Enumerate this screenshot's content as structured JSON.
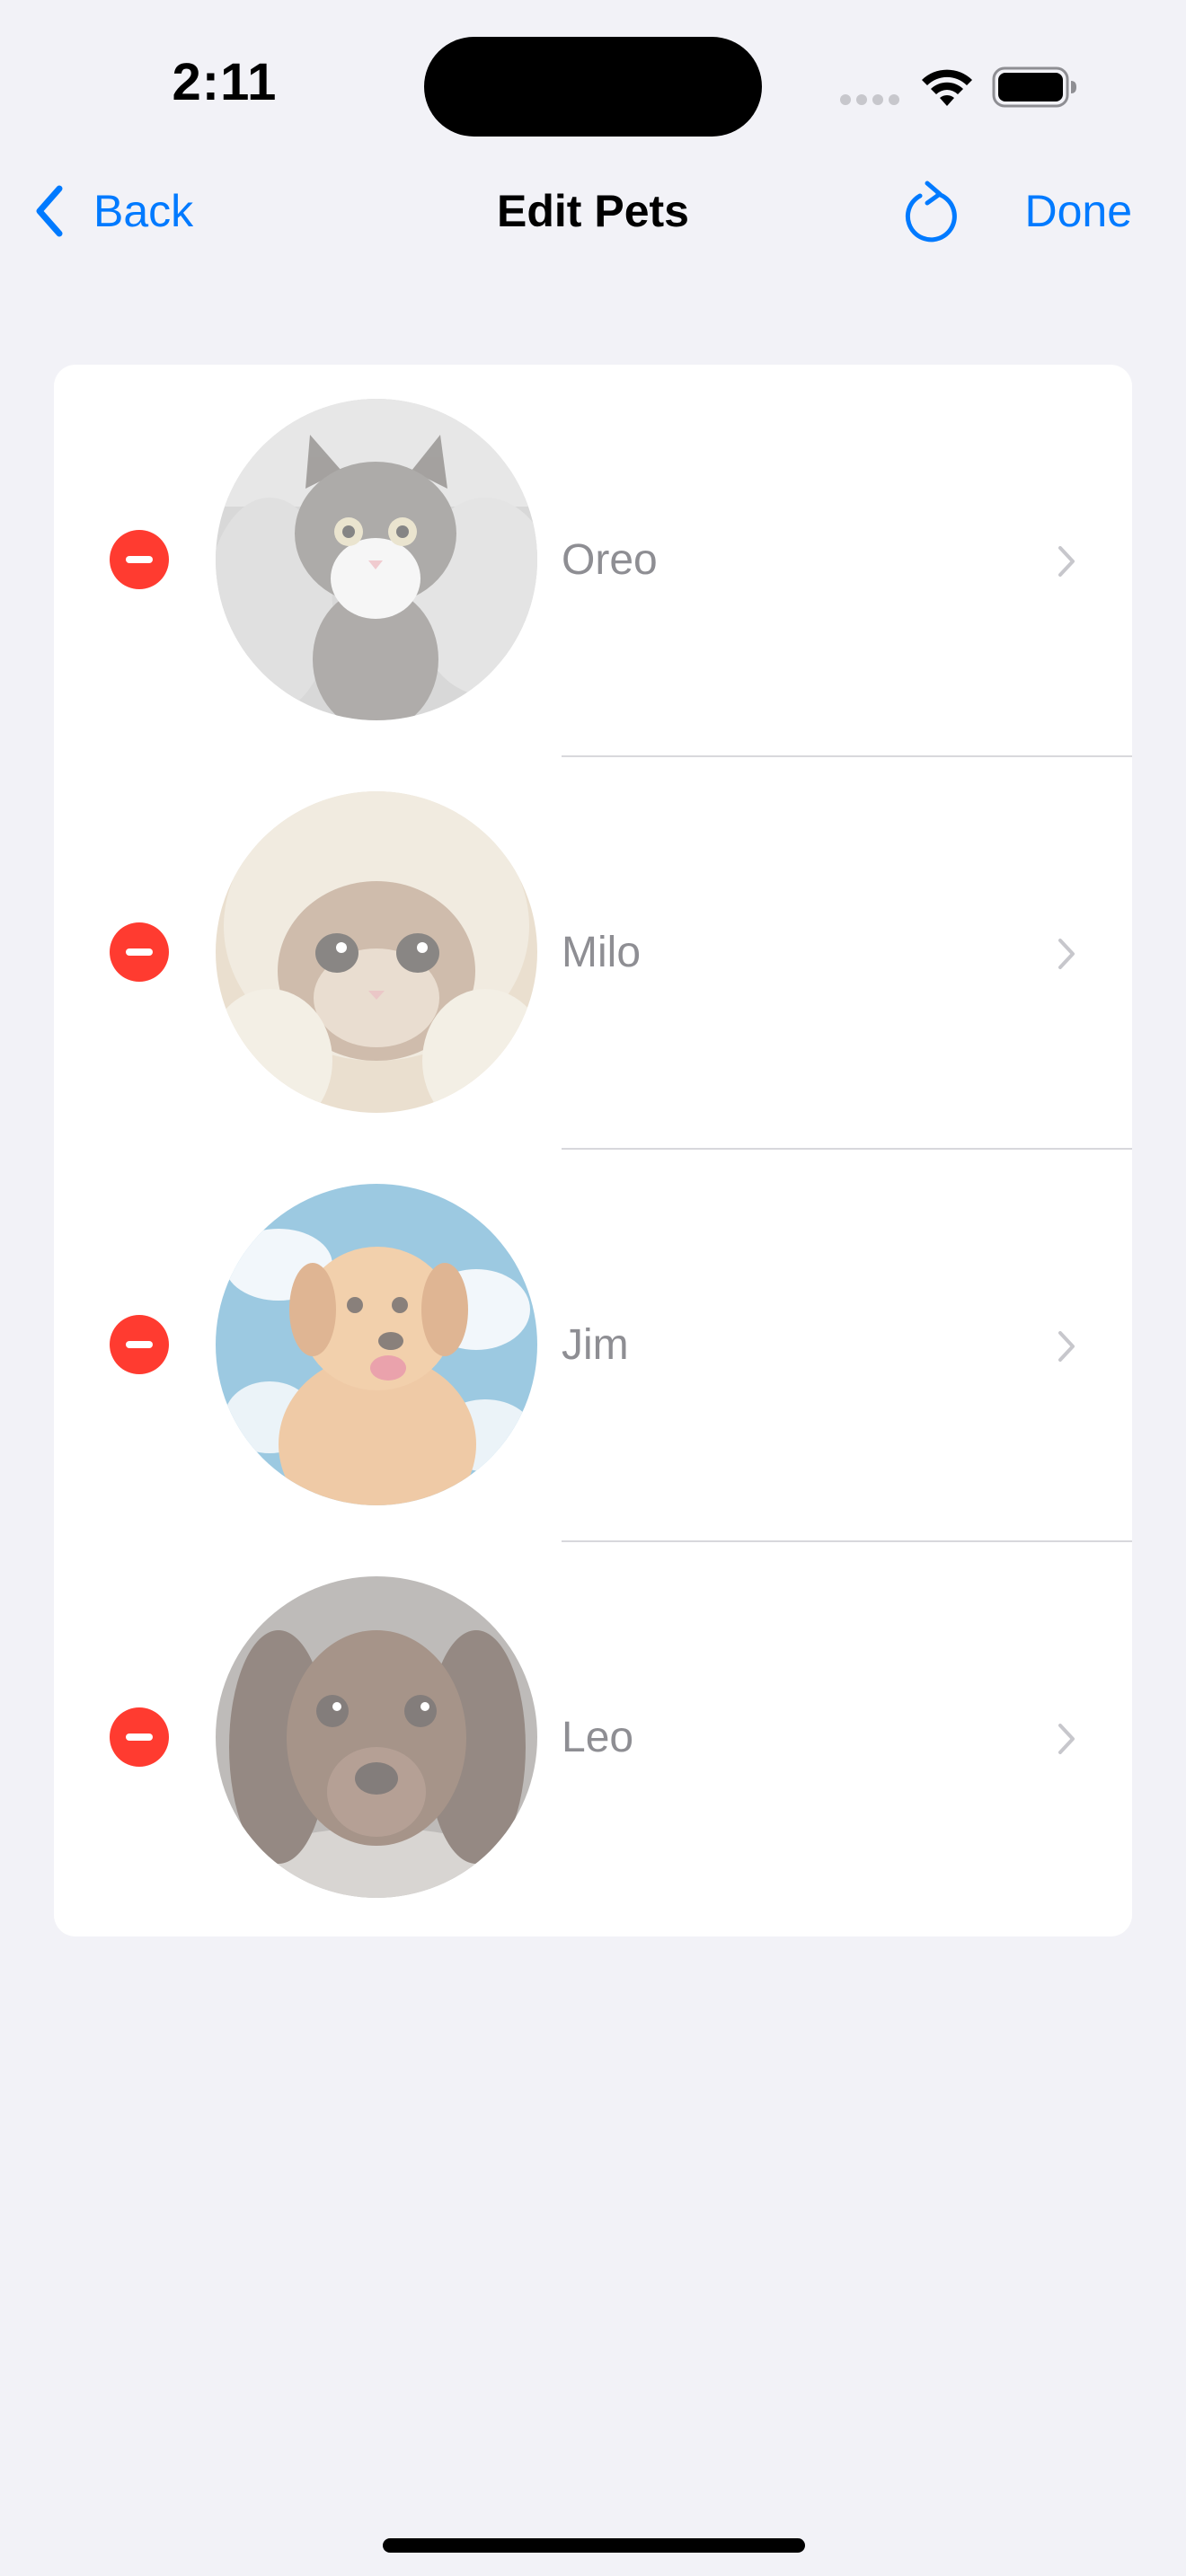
{
  "status_bar": {
    "time": "2:11"
  },
  "nav": {
    "back_label": "Back",
    "title": "Edit Pets",
    "done_label": "Done"
  },
  "pets": [
    {
      "name": "Oreo",
      "photo": "gray-tabby-kitten"
    },
    {
      "name": "Milo",
      "photo": "kitten-in-blanket"
    },
    {
      "name": "Jim",
      "photo": "golden-retriever-puppy"
    },
    {
      "name": "Leo",
      "photo": "brown-dachshund-puppy"
    }
  ],
  "colors": {
    "accent": "#007aff",
    "delete": "#ff3b30",
    "background": "#f2f2f7",
    "card": "#ffffff",
    "disabled_text": "#8e8e93"
  },
  "icons": {
    "back": "chevron-left-icon",
    "refresh": "refresh-icon",
    "delete": "minus-circle-icon",
    "disclosure": "chevron-right-icon"
  }
}
